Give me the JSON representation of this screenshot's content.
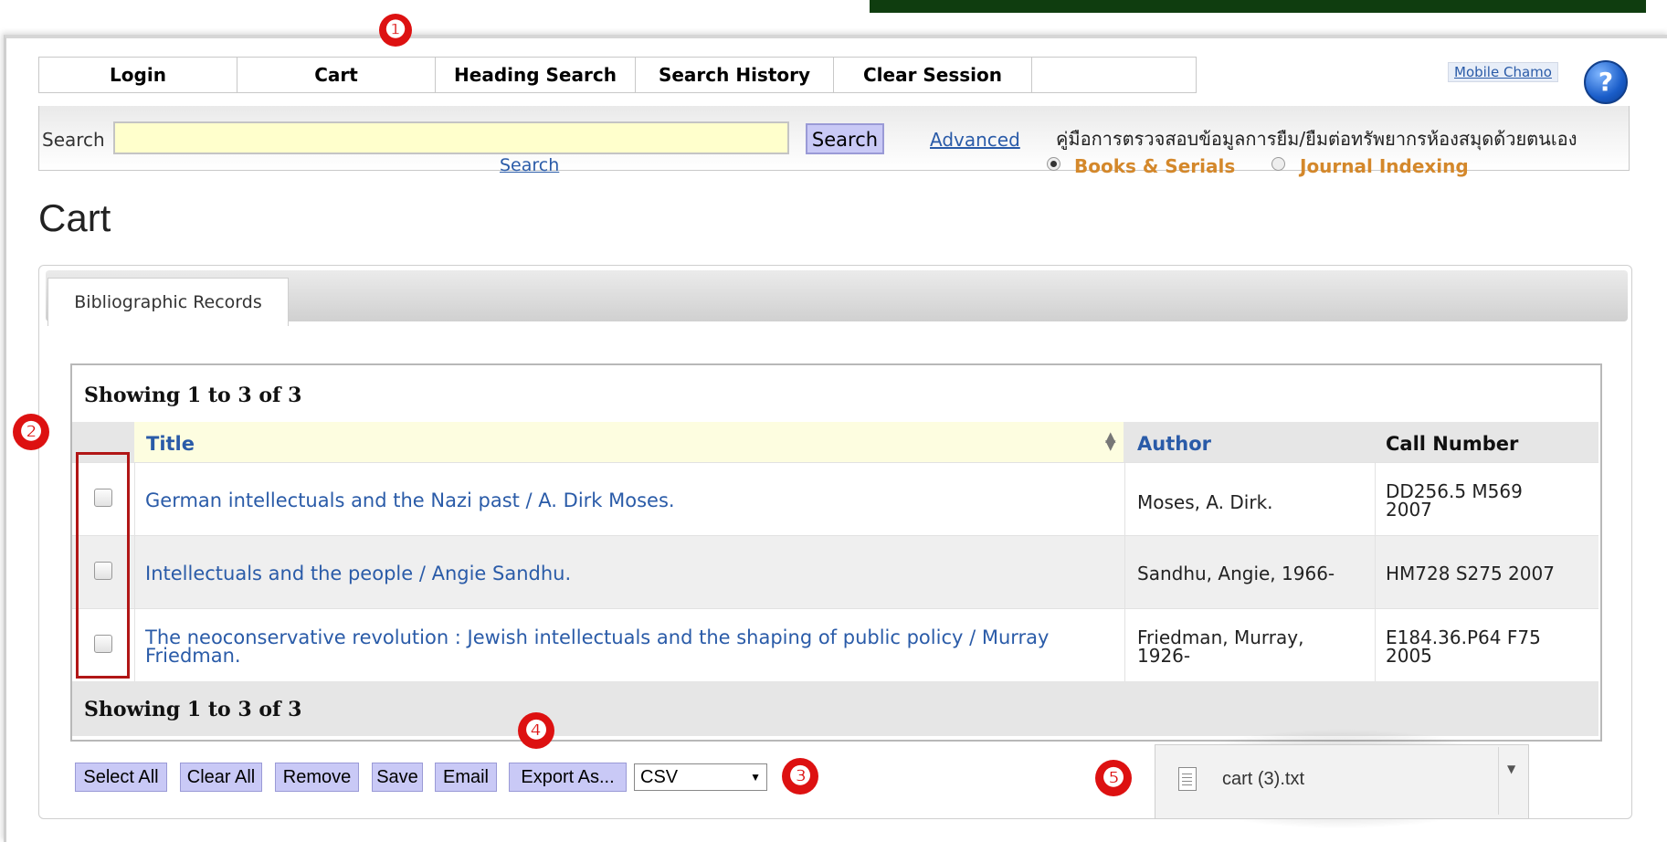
{
  "nav": {
    "items": [
      "Login",
      "Cart",
      "Heading Search",
      "Search History",
      "Clear Session"
    ],
    "mobile_link": "Mobile Chamo",
    "help": "?"
  },
  "search": {
    "label": "Search",
    "input_value": "",
    "button": "Search",
    "advanced": "Advanced",
    "search_link": "Search",
    "thai_notice": "คู่มือการตรวจสอบข้อมูลการยืม/ยืมต่อทรัพยากรห้องสมุดด้วยตนเอง",
    "options": [
      "Books & Serials",
      "Journal Indexing"
    ],
    "selected_option": "Books & Serials"
  },
  "page": {
    "title": "Cart"
  },
  "tabs": [
    "Bibliographic Records"
  ],
  "results": {
    "showing": "Showing 1 to 3 of 3",
    "columns": [
      "Title",
      "Author",
      "Call Number"
    ],
    "rows": [
      {
        "title": "German intellectuals and the Nazi past / A. Dirk Moses.",
        "author": "Moses, A. Dirk.",
        "call_number": "DD256.5 M569 2007",
        "checked": false
      },
      {
        "title": "Intellectuals and the people / Angie Sandhu.",
        "author": "Sandhu, Angie, 1966-",
        "call_number": "HM728 S275 2007",
        "checked": false
      },
      {
        "title": "The neoconservative revolution : Jewish intellectuals and the shaping of public policy / Murray Friedman.",
        "author": "Friedman, Murray, 1926-",
        "call_number": "E184.36.P64 F75 2005",
        "checked": false
      }
    ]
  },
  "actions": {
    "select_all": "Select All",
    "clear_all": "Clear All",
    "remove": "Remove",
    "save": "Save",
    "email": "Email",
    "export": "Export As...",
    "format": "CSV"
  },
  "download": {
    "file_name": "cart (3).txt",
    "icon": "document-icon"
  },
  "markers": [
    "❶",
    "❷",
    "❸",
    "❹",
    "❺"
  ],
  "colors": {
    "accent_link": "#2a5ba8",
    "button_bg": "#c9c9f6",
    "marker_red": "#dd1111",
    "option_orange": "#d4882b",
    "input_yellow": "#ffffcc"
  }
}
